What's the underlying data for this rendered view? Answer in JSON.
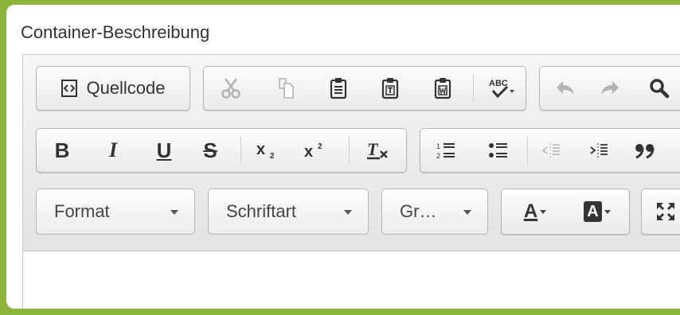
{
  "field_label": "Container-Beschreibung",
  "toolbar": {
    "source_label": "Quellcode",
    "format_label": "Format",
    "font_label": "Schriftart",
    "size_label": "Gr…",
    "bold": "B",
    "italic": "I",
    "underline": "U",
    "strike": "S",
    "spell": "ABC",
    "text_color": "A",
    "bg_color": "A"
  },
  "colors": {
    "page_bg": "#8cb33a",
    "icon": "#333333",
    "disabled_icon": "#b3b3b3"
  }
}
